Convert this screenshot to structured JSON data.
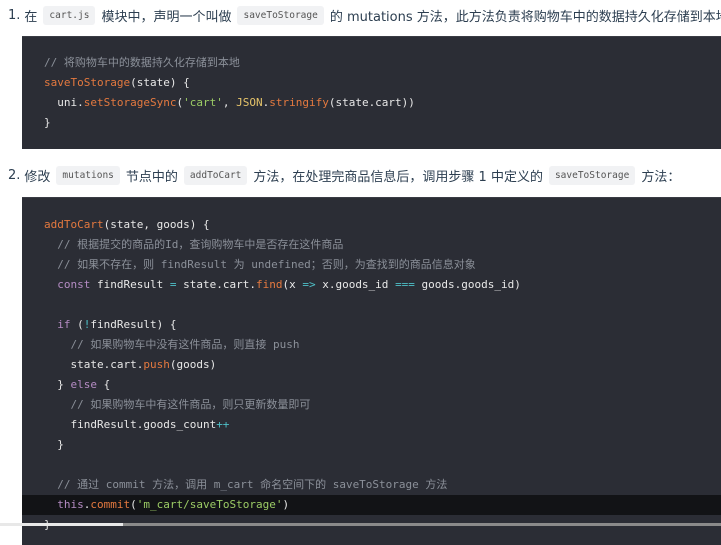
{
  "step1": {
    "num": "1.",
    "parts": [
      {
        "t": "在"
      },
      {
        "c": "cart.js"
      },
      {
        "t": "模块中，声明一个叫做"
      },
      {
        "c": "saveToStorage"
      },
      {
        "t": "的 mutations 方法，此方法负责将购物车中的数据持久化存储到本地："
      }
    ]
  },
  "code1": [
    [
      [
        "cm",
        "// 将购物车中的数据持久化存储到本地"
      ]
    ],
    [
      [
        "fn",
        "saveToStorage"
      ],
      [
        "plain",
        "(state) {"
      ]
    ],
    [
      [
        "plain",
        "  uni."
      ],
      [
        "fn",
        "setStorageSync"
      ],
      [
        "plain",
        "("
      ],
      [
        "str",
        "'cart'"
      ],
      [
        "plain",
        ", "
      ],
      [
        "obj",
        "JSON"
      ],
      [
        "plain",
        "."
      ],
      [
        "fn",
        "stringify"
      ],
      [
        "plain",
        "(state.cart))"
      ]
    ],
    [
      [
        "plain",
        "}"
      ]
    ]
  ],
  "step2": {
    "num": "2.",
    "parts": [
      {
        "t": "修改"
      },
      {
        "c": "mutations"
      },
      {
        "t": "节点中的"
      },
      {
        "c": "addToCart"
      },
      {
        "t": "方法，在处理完商品信息后，调用步骤 1 中定义的"
      },
      {
        "c": "saveToStorage"
      },
      {
        "t": "方法："
      }
    ]
  },
  "code2": [
    [
      [
        "fn",
        "addToCart"
      ],
      [
        "plain",
        "(state, goods) {"
      ]
    ],
    [
      [
        "cm",
        "  // 根据提交的商品的Id，查询购物车中是否存在这件商品"
      ]
    ],
    [
      [
        "cm",
        "  // 如果不存在，则 findResult 为 undefined；否则，为查找到的商品信息对象"
      ]
    ],
    [
      [
        "kw",
        "  const"
      ],
      [
        "plain",
        " findResult "
      ],
      [
        "op",
        "="
      ],
      [
        "plain",
        " state.cart."
      ],
      [
        "fn",
        "find"
      ],
      [
        "plain",
        "(x "
      ],
      [
        "op",
        "=>"
      ],
      [
        "plain",
        " x.goods_id "
      ],
      [
        "op",
        "==="
      ],
      [
        "plain",
        " goods.goods_id)"
      ]
    ],
    [],
    [
      [
        "kw",
        "  if"
      ],
      [
        "plain",
        " ("
      ],
      [
        "op",
        "!"
      ],
      [
        "plain",
        "findResult) {"
      ]
    ],
    [
      [
        "cm",
        "    // 如果购物车中没有这件商品，则直接 push"
      ]
    ],
    [
      [
        "plain",
        "    state.cart."
      ],
      [
        "fn",
        "push"
      ],
      [
        "plain",
        "(goods)"
      ]
    ],
    [
      [
        "plain",
        "  } "
      ],
      [
        "kw",
        "else"
      ],
      [
        "plain",
        " {"
      ]
    ],
    [
      [
        "cm",
        "    // 如果购物车中有这件商品，则只更新数量即可"
      ]
    ],
    [
      [
        "plain",
        "    findResult.goods_count"
      ],
      [
        "op",
        "++"
      ]
    ],
    [
      [
        "plain",
        "  }"
      ]
    ],
    [],
    [
      [
        "cm",
        "  // 通过 commit 方法，调用 m_cart 命名空间下的 saveToStorage 方法"
      ]
    ],
    [
      [
        "kw",
        "  this"
      ],
      [
        "plain",
        "."
      ],
      [
        "fn",
        "commit"
      ],
      [
        "plain",
        "("
      ],
      [
        "str",
        "'m_cart/saveToStorage'"
      ],
      [
        "plain",
        ")"
      ]
    ],
    [
      [
        "plain",
        "}"
      ]
    ]
  ],
  "highlight_line": 14,
  "video_progress": 0.17
}
